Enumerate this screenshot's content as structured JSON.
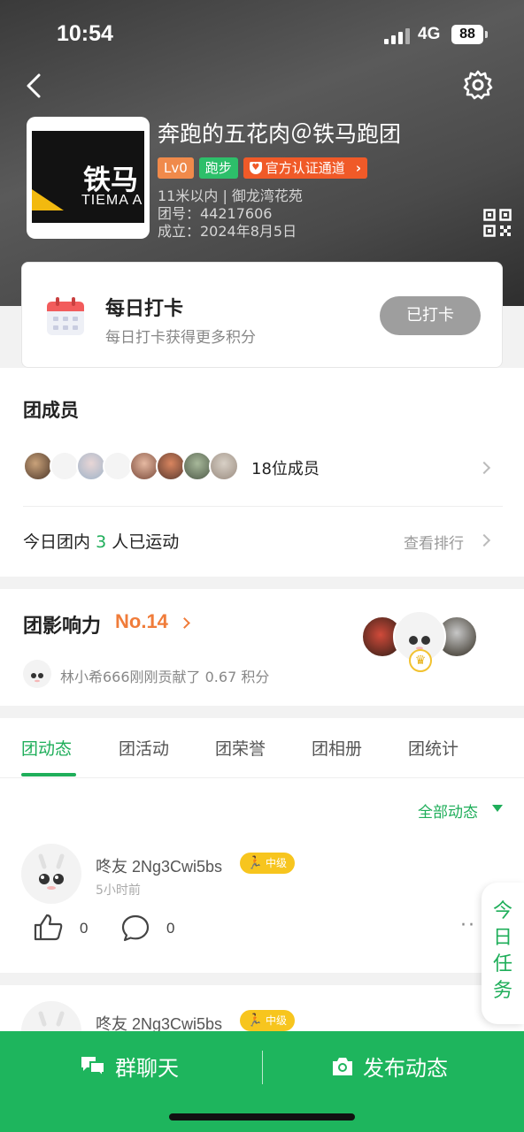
{
  "status_bar": {
    "time": "10:54",
    "network": "4G",
    "battery": "88"
  },
  "team": {
    "name": "奔跑的五花肉＠铁马跑团",
    "logo_text_cn": "铁马",
    "logo_text_en": "TIEMA A",
    "tags": {
      "level": "Lv0",
      "sport": "跑步",
      "official": "官方认证通道"
    },
    "distance_location": "11米以内 | 御龙湾花苑",
    "team_no": "团号：44217606",
    "founded": "成立：2024年8月5日"
  },
  "checkin": {
    "title": "每日打卡",
    "subtitle": "每日打卡获得更多积分",
    "button": "已打卡"
  },
  "members": {
    "title": "团成员",
    "count": "18位成员",
    "today_prefix": "今日团内",
    "today_num": "3",
    "today_suffix": "人已运动",
    "ranking_link": "查看排行"
  },
  "influence": {
    "title": "团影响力",
    "rank": "No.14",
    "contribution": "林小希666刚刚贡献了 0.67 积分"
  },
  "tabs": [
    "团动态",
    "团活动",
    "团荣誉",
    "团相册",
    "团统计"
  ],
  "feed": {
    "filter": "全部动态",
    "posts": [
      {
        "user": "咚友 2Ng3Cwi5bs",
        "level": "中级",
        "time": "5小时前",
        "likes": "0",
        "comments": "0"
      },
      {
        "user": "咚友 2Ng3Cwi5bs",
        "level": "中级"
      }
    ]
  },
  "task_widget": [
    "今",
    "日",
    "任",
    "务"
  ],
  "bottom_bar": {
    "chat": "群聊天",
    "post": "发布动态"
  },
  "colors": {
    "primary": "#1eb55d",
    "accent_orange": "#f07c3a",
    "level_yellow": "#f7c51e"
  }
}
